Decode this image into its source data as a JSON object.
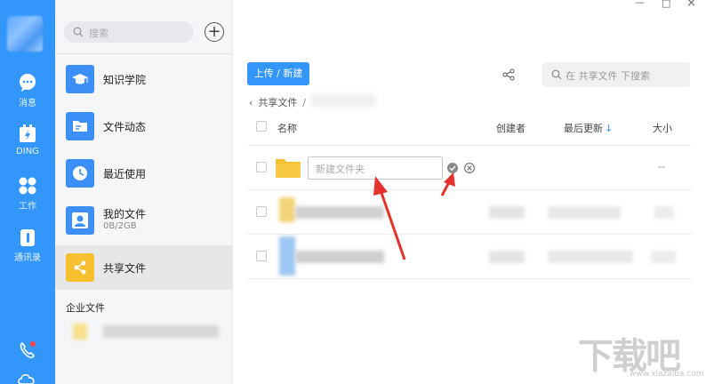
{
  "rail": {
    "items": [
      {
        "label": "消息",
        "icon": "chat-bubble-icon"
      },
      {
        "label": "DING",
        "icon": "ding-icon"
      },
      {
        "label": "工作",
        "icon": "workbench-icon"
      },
      {
        "label": "通讯录",
        "icon": "contacts-icon"
      }
    ]
  },
  "sidebar": {
    "search_placeholder": "搜索",
    "add_button": "+",
    "items": [
      {
        "title": "知识学院",
        "sub": "",
        "icon": "graduation-cap-icon",
        "color": "#3b8ff6"
      },
      {
        "title": "文件动态",
        "sub": "",
        "icon": "folder-icon",
        "color": "#3b8ff6"
      },
      {
        "title": "最近使用",
        "sub": "",
        "icon": "clock-icon",
        "color": "#3b8ff6"
      },
      {
        "title": "我的文件",
        "sub": "0B/2GB",
        "icon": "user-icon",
        "color": "#3b8ff6"
      },
      {
        "title": "共享文件",
        "sub": "",
        "icon": "share-icon",
        "color": "#f6c02e"
      }
    ],
    "section_label": "企业文件"
  },
  "window": {
    "minimize": "—",
    "maximize": "□",
    "close": "×"
  },
  "main": {
    "upload_button": "上传 / 新建",
    "search_placeholder": "在 共享文件 下搜索",
    "breadcrumb": {
      "back": "‹",
      "current": "共享文件",
      "sep": "/"
    },
    "columns": {
      "name": "名称",
      "creator": "创建者",
      "updated": "最后更新",
      "updated_arrow": "↓",
      "size": "大小"
    },
    "new_folder": {
      "placeholder": "新建文件夹",
      "size": "--"
    }
  },
  "watermark": {
    "text": "下载吧",
    "url": "www.xiazaiba.com"
  },
  "colors": {
    "accent": "#3296fa",
    "share_tile": "#f6c02e",
    "annotation": "#e5322d"
  }
}
